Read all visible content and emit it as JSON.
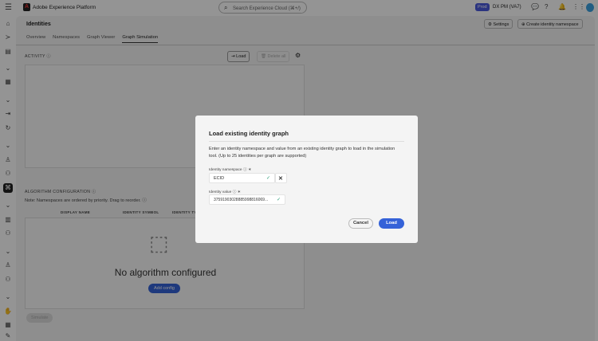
{
  "topbar": {
    "app_name": "Adobe Experience Platform",
    "search_placeholder": "Search Experience Cloud (⌘+/)",
    "env_badge": "Prod",
    "org": "DX PM (VA7)"
  },
  "header": {
    "title": "Identities",
    "settings": "Settings",
    "create": "Create identity namespace"
  },
  "tabs": [
    "Overview",
    "Namespaces",
    "Graph Viewer",
    "Graph Simulation"
  ],
  "activity": {
    "label": "ACTIVITY",
    "load": "Load",
    "delete_all": "Delete all"
  },
  "algorithm": {
    "label": "ALGORITHM CONFIGURATION",
    "note": "Note: Namespaces are ordered by priority. Drag to reorder.",
    "columns": [
      "DISPLAY NAME",
      "IDENTITY SYMBOL",
      "IDENTITY TYPE"
    ],
    "empty": "No algorithm configured",
    "add": "Add config",
    "simulate": "Simulate"
  },
  "modal": {
    "title": "Load existing identity graph",
    "description": "Enter an identity namespace and value from an existing identity graph to load in the simulation tool. (Up to 25 identities per graph are supported)",
    "namespace_label": "Identity namespace",
    "namespace_value": "ECID",
    "value_label": "Identity value",
    "value_value": "37591903028885998816069...",
    "cancel": "Cancel",
    "load": "Load"
  }
}
